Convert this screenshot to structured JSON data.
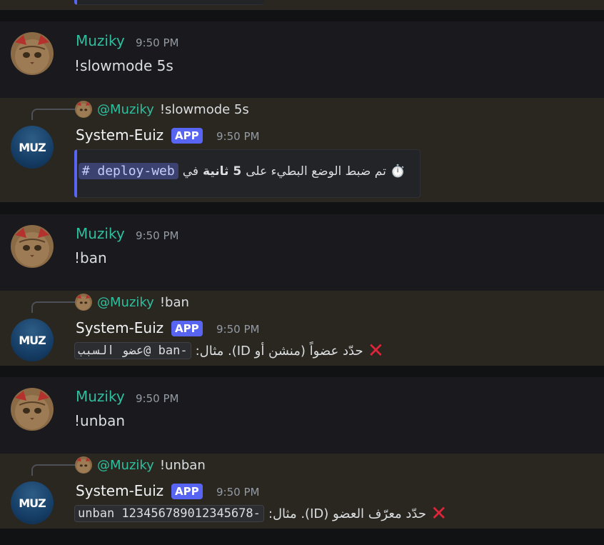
{
  "messages": {
    "m1": {
      "username": "Muziky",
      "time": "9:50 PM",
      "text": "!slowmode 5s"
    },
    "r1": {
      "reply_mention": "@Muziky",
      "reply_text": "!slowmode 5s",
      "username": "System-Euiz",
      "tag": "APP",
      "time": "9:50 PM",
      "embed_emoji": "⏱️",
      "embed_text_a": "تم ضبط الوضع البطيء على",
      "embed_bold": "5 ثانية",
      "embed_text_b": "في",
      "channel": "# deploy-web"
    },
    "m2": {
      "username": "Muziky",
      "time": "9:50 PM",
      "text": "!ban"
    },
    "r2": {
      "reply_mention": "@Muziky",
      "reply_text": "!ban",
      "username": "System-Euiz",
      "tag": "APP",
      "time": "9:50 PM",
      "error_text": "حدّد عضواً (منشن أو ID). مثال:",
      "code": "-ban @عضو السبب"
    },
    "m3": {
      "username": "Muziky",
      "time": "9:50 PM",
      "text": "!unban"
    },
    "r3": {
      "reply_mention": "@Muziky",
      "reply_text": "!unban",
      "username": "System-Euiz",
      "tag": "APP",
      "time": "9:50 PM",
      "error_text": "حدّد معرّف العضو (ID). مثال:",
      "code": "-unban 123456789012345678"
    },
    "bot_avatar_text": "MUZ"
  },
  "colors": {
    "user_name": "#2ebf9f",
    "app_tag": "#5865f2",
    "highlight_bg": "#2a2620",
    "error_x": "#e0243a"
  },
  "icons": {
    "error": "cross-mark-icon",
    "timer": "stopwatch-icon"
  }
}
